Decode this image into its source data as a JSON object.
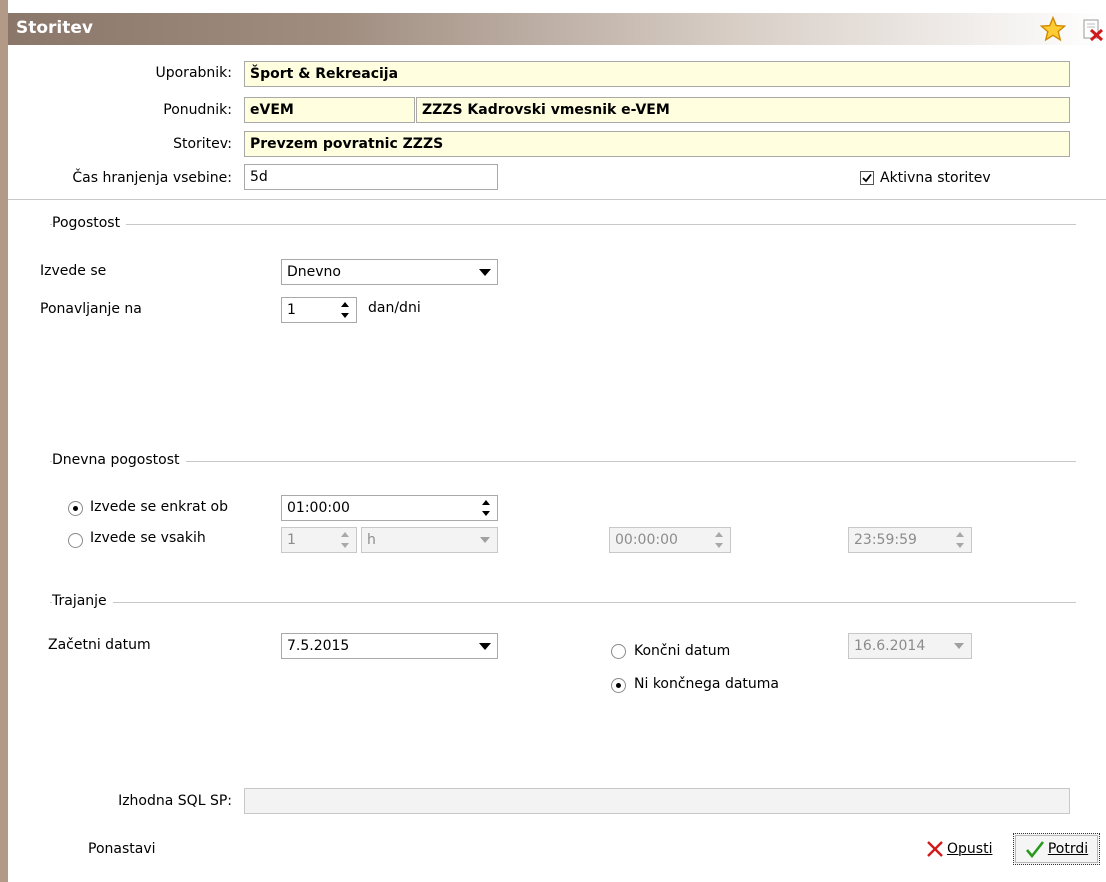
{
  "window": {
    "title": "Storitev"
  },
  "fields": {
    "user_label": "Uporabnik:",
    "user_value": "Šport & Rekreacija",
    "provider_label": "Ponudnik:",
    "provider_code": "eVEM",
    "provider_name": "ZZZS Kadrovski vmesnik e-VEM",
    "service_label": "Storitev:",
    "service_value": "Prevzem povratnic ZZZS",
    "retention_label": "Čas hranjenja vsebine:",
    "retention_value": "5d",
    "active_label": "Aktivna storitev",
    "active_checked": true
  },
  "frequency": {
    "group_title": "Pogostost",
    "runs_label": "Izvede se",
    "runs_value": "Dnevno",
    "repeat_label": "Ponavljanje na",
    "repeat_value": "1",
    "repeat_unit": "dan/dni"
  },
  "daily": {
    "group_title": "Dnevna pogostost",
    "once_label": "Izvede se enkrat ob",
    "once_time": "01:00:00",
    "every_label": "Izvede se vsakih",
    "every_value": "1",
    "every_unit": "h",
    "from_time": "00:00:00",
    "to_time": "23:59:59",
    "selected": "once"
  },
  "duration": {
    "group_title": "Trajanje",
    "start_label": "Začetni datum",
    "start_value": "7.5.2015",
    "end_label": "Končni datum",
    "end_value": "16.6.2014",
    "no_end_label": "Ni končnega datuma",
    "selected": "no_end"
  },
  "output": {
    "sql_label": "Izhodna SQL SP:",
    "sql_value": ""
  },
  "buttons": {
    "reset": "Ponastavi",
    "cancel": "Opusti",
    "confirm": "Potrdi"
  },
  "colors": {
    "highlight_field": "#ffffdf",
    "titlebar": "#8a776a",
    "cancel_icon": "#d11a1a",
    "confirm_icon": "#2a9a1e"
  },
  "icons": {
    "favorite": "star-icon",
    "close": "close-icon",
    "cancel": "x-icon",
    "confirm": "checkmark-icon"
  }
}
